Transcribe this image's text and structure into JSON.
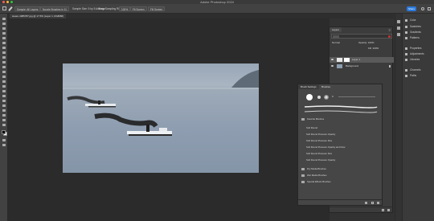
{
  "app": {
    "window_title": "Adobe Photoshop 2024",
    "document_tab": "steam-4985787.jpg @ 17.5% (Layer 1, RGB/8#)"
  },
  "options_bar": {
    "sample_label": "Sample: All Layers",
    "brush_preset_label": "Nozzle Brushes in 11",
    "sample_size": "Sample Size: 5 by 5 Average",
    "show_sampling_ring": "Show Sampling Ring",
    "zoom": "100%",
    "fit_screen": "Fit Screen",
    "fill_screen": "Fill Screen",
    "share_label": "Share"
  },
  "right_dock": {
    "items": [
      {
        "label": "Color",
        "icon": "color-icon"
      },
      {
        "label": "Swatches",
        "icon": "swatches-icon"
      },
      {
        "label": "Gradients",
        "icon": "gradients-icon"
      },
      {
        "label": "Patterns",
        "icon": "patterns-icon"
      },
      {
        "label": "Properties",
        "icon": "properties-icon"
      },
      {
        "label": "Adjustments",
        "icon": "adjustments-icon"
      },
      {
        "label": "Libraries",
        "icon": "libraries-icon"
      },
      {
        "label": "Channels",
        "icon": "channels-icon"
      },
      {
        "label": "Paths",
        "icon": "paths-icon"
      }
    ]
  },
  "layers_panel": {
    "tab": "Layers",
    "blend_mode": "Normal",
    "opacity": "Opacity: 100%",
    "fill": "Fill: 100%",
    "layers": [
      {
        "name": "Layer 1",
        "selected": true
      },
      {
        "name": "Background",
        "selected": false
      }
    ]
  },
  "brushes_panel": {
    "tabs": [
      "Brush Settings",
      "Brushes"
    ],
    "size_value": "9",
    "groups": [
      {
        "name": "Favorite Brushes"
      },
      {
        "name": "Soft Round"
      },
      {
        "name": "Soft Round Pressure Opacity"
      },
      {
        "name": "Soft Round Pressure Size"
      },
      {
        "name": "Soft Round Pressure Opacity and Flow"
      },
      {
        "name": "Soft Round Pressure Size"
      },
      {
        "name": "Soft Round Pressure Opacity"
      },
      {
        "name": "Dry Media Brushes"
      },
      {
        "name": "Wet Media Brushes"
      },
      {
        "name": "Special Effects Brushes"
      }
    ]
  },
  "colors": {
    "accent": "#2a7bde",
    "foreground_swatch": "#000000",
    "background_swatch": "#ffffff"
  }
}
